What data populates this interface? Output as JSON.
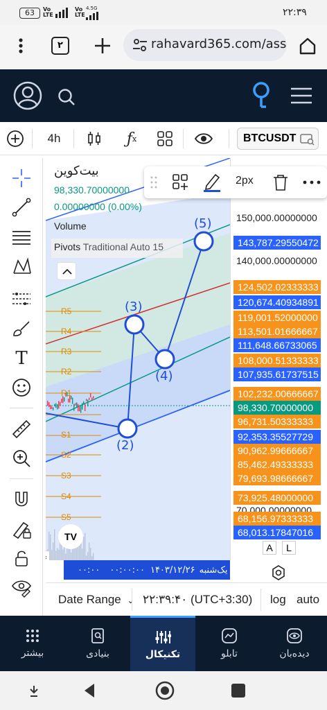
{
  "status": {
    "time": "۲۲:۳۹",
    "battery": "63",
    "net1": "Vo LTE",
    "net2": "4.5G"
  },
  "browser": {
    "tabs_count": "۲",
    "url": "rahavard365.com/ass"
  },
  "toolbar": {
    "interval": "4h",
    "symbol": "BTCUSDT"
  },
  "chart": {
    "title": "بیت‌کوین",
    "price": "98,330.70000000",
    "change": "0.00000000 (0.00%)",
    "indicator_volume": "Volume",
    "indicator_pivots": "Pivots",
    "indicator_pivots_params": "Traditional Auto 15",
    "pivot_levels": [
      "R5",
      "R4",
      "R3",
      "R2",
      "R1",
      "S1",
      "S2",
      "S3",
      "S4",
      "S5"
    ],
    "wave_labels": [
      "(5)",
      "(3)",
      "(4)",
      "(2)"
    ]
  },
  "drawbar": {
    "width_label": "2px"
  },
  "price_scale": {
    "top_label": "150,000.00000000",
    "labels": [
      {
        "text": "143,787.29550472",
        "color": "#2962ff"
      },
      {
        "text": "140,000.00000000",
        "color": "none"
      },
      {
        "text": "124,502.02333333",
        "color": "#f7931a"
      },
      {
        "text": "120,674.40934891",
        "color": "#2962ff"
      },
      {
        "text": "119,001.52000000",
        "color": "#f7931a"
      },
      {
        "text": "113,501.01666667",
        "color": "#f7931a"
      },
      {
        "text": "111,648.66733065",
        "color": "#2962ff"
      },
      {
        "text": "108,000.51333333",
        "color": "#f7931a"
      },
      {
        "text": "107,935.61737515",
        "color": "#2962ff"
      },
      {
        "text": "102,232.00666667",
        "color": "#f7931a"
      },
      {
        "text": "98,330.70000000",
        "color": "#089981"
      },
      {
        "text": "96,731.50333333",
        "color": "#f7931a"
      },
      {
        "text": "92,353.35527729",
        "color": "#2962ff"
      },
      {
        "text": "90,962.99666667",
        "color": "#f7931a"
      },
      {
        "text": "85,462.49333333",
        "color": "#f7931a"
      },
      {
        "text": "79,693.98666667",
        "color": "#f7931a"
      },
      {
        "text": "73,925.48000000",
        "color": "#f7931a"
      },
      {
        "text": "70,000.00000000",
        "color": "none"
      },
      {
        "text": "68,156.97333333",
        "color": "#f7931a"
      },
      {
        "text": "68,013.17847016",
        "color": "#2962ff"
      }
    ],
    "btn_a": "A",
    "btn_l": "L"
  },
  "datebar": {
    "left_time": "۰۰:۰۰",
    "left_time2": "۰۰:۰۰:۰۰",
    "date": "۱۴۰۳/۱۲/۲۶",
    "day": "یک‌شنبه"
  },
  "controls": {
    "date_range": "Date Range",
    "clock": "۲۲:۳۹:۴۰ (UTC+3:30)",
    "log": "log",
    "auto": "auto"
  },
  "bottom_nav": [
    {
      "label": "بیشتر",
      "icon": "grid-dots-icon"
    },
    {
      "label": "بنیادی",
      "icon": "document-search-icon"
    },
    {
      "label": "تکنیکال",
      "icon": "sliders-icon",
      "active": true
    },
    {
      "label": "تابلو",
      "icon": "chart-circle-icon"
    },
    {
      "label": "دیده‌بان",
      "icon": "eye-icon"
    }
  ]
}
